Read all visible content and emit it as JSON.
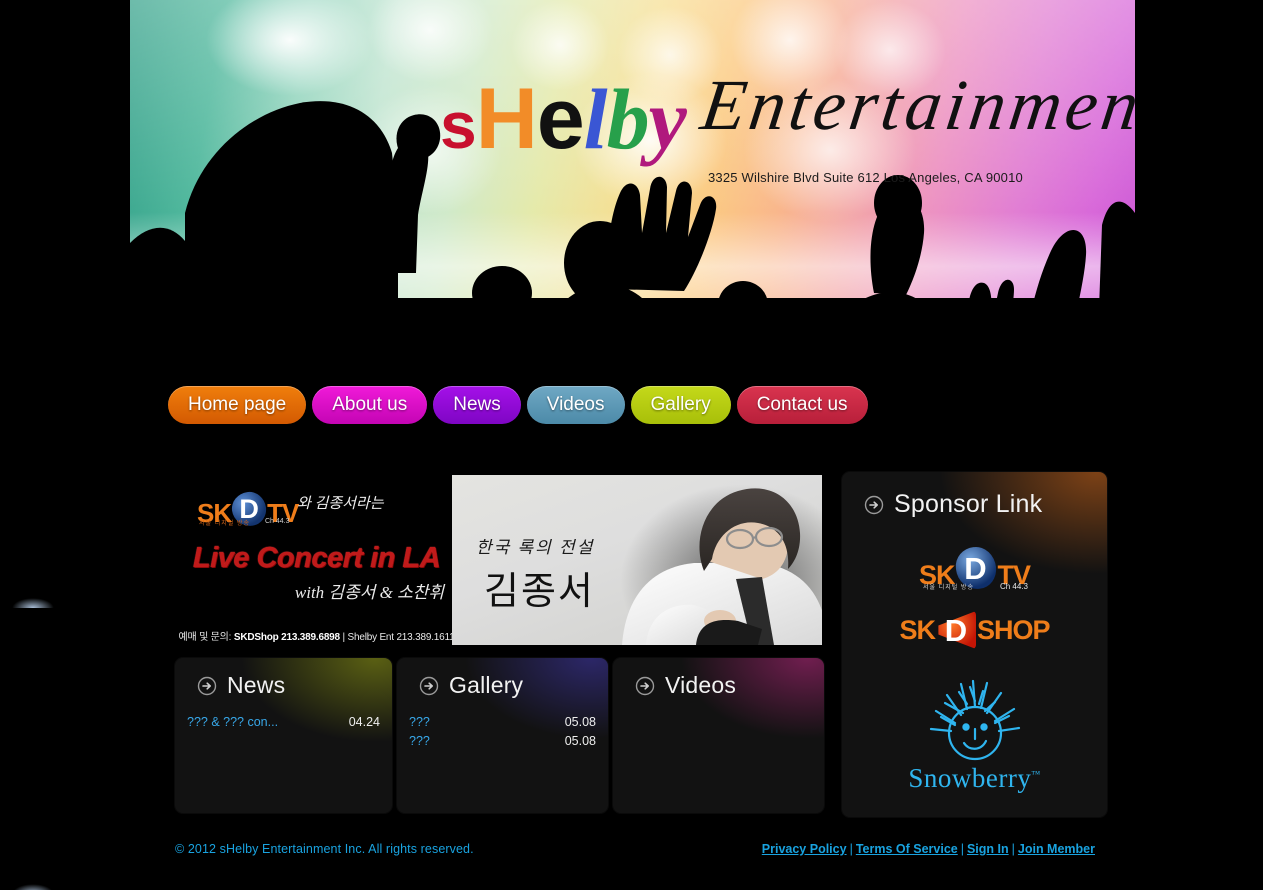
{
  "site": {
    "logo": {
      "word_parts": [
        "s",
        "H",
        "e",
        "l",
        "b",
        "y"
      ],
      "script_word": "Entertainment",
      "address": "3325 Wilshire Blvd Suite 612  Los Angeles,  CA 90010"
    }
  },
  "nav": {
    "items": [
      {
        "label": "Home page",
        "color": "#e06b06"
      },
      {
        "label": "About us",
        "color": "#e012c8"
      },
      {
        "label": "News",
        "color": "#9409d8"
      },
      {
        "label": "Videos",
        "color": "#5f9ab8"
      },
      {
        "label": "Gallery",
        "color": "#b9d012"
      },
      {
        "label": "Contact us",
        "color": "#c8293f"
      }
    ]
  },
  "promo_banner": {
    "station_sk": "SK",
    "station_d": "D",
    "station_tv": "TV",
    "station_sub": "서울 디지털 방송",
    "station_channel": "Ch 44.3",
    "station_korean": "와 김종서라는",
    "headline": "Live Concert in LA",
    "with_line": "with 김종서 & 소찬휘",
    "footer_label": "예매 및 문의:",
    "footer_shop": "SKDShop 213.389.6898",
    "footer_sep": "|",
    "footer_ent": "Shelby Ent 213.389.1611"
  },
  "artist_image": {
    "caption_small": "한국 록의 전설",
    "caption_big": "김종서"
  },
  "panels": {
    "news": {
      "title": "News",
      "icon": "arrow-circle-right-icon",
      "accent": "#96a014",
      "items": [
        {
          "title": "??? & ??? con...",
          "date": "04.24"
        }
      ]
    },
    "gallery": {
      "title": "Gallery",
      "icon": "arrow-circle-right-icon",
      "accent": "#463cbe",
      "items": [
        {
          "title": "???",
          "date": "05.08"
        },
        {
          "title": "???",
          "date": "05.08"
        }
      ]
    },
    "videos": {
      "title": "Videos",
      "icon": "arrow-circle-right-icon",
      "accent": "#be2882",
      "items": []
    },
    "sponsor": {
      "title": "Sponsor Link",
      "icon": "arrow-circle-right-icon",
      "accent": "#be5f19",
      "logos": [
        {
          "name": "skd-tv-logo",
          "sk": "SK",
          "d": "D",
          "tail": "TV",
          "sub": "서울 디지털 방송",
          "channel": "Ch 44.3"
        },
        {
          "name": "skd-shop-logo",
          "sk": "SK",
          "d": "D",
          "tail": "SHOP",
          "sub": "",
          "channel": ""
        },
        {
          "name": "snowberry-logo",
          "word": "Snowberry",
          "tm": "™"
        }
      ]
    }
  },
  "footer": {
    "copyright": "© 2012 sHelby Entertainment Inc. All rights reserved.",
    "links": [
      {
        "label": "Privacy Policy"
      },
      {
        "label": "Terms Of Service"
      },
      {
        "label": "Sign In"
      },
      {
        "label": "Join Member"
      }
    ],
    "separator": "|"
  }
}
